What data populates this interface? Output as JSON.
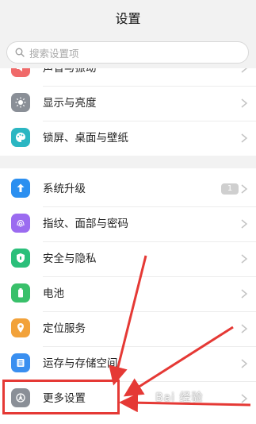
{
  "header": {
    "title": "设置"
  },
  "search": {
    "placeholder": "搜索设置项"
  },
  "group1": {
    "items": [
      {
        "label": "声音与振动",
        "icon": "sound-icon",
        "color": "#f06a6a"
      },
      {
        "label": "显示与亮度",
        "icon": "sun-icon",
        "color": "#8a8f97"
      },
      {
        "label": "锁屏、桌面与壁纸",
        "icon": "palette-icon",
        "color": "#2bb6c2"
      }
    ]
  },
  "group2": {
    "items": [
      {
        "label": "系统升级",
        "icon": "update-icon",
        "color": "#2b8ff0",
        "badge": "1"
      },
      {
        "label": "指纹、面部与密码",
        "icon": "fingerprint-icon",
        "color": "#9b6bf0"
      },
      {
        "label": "安全与隐私",
        "icon": "shield-icon",
        "color": "#2bbf7a"
      },
      {
        "label": "电池",
        "icon": "battery-icon",
        "color": "#39c06a"
      },
      {
        "label": "定位服务",
        "icon": "location-icon",
        "color": "#f2a23a"
      },
      {
        "label": "运存与存储空间",
        "icon": "storage-icon",
        "color": "#3a8ff0"
      },
      {
        "label": "更多设置",
        "icon": "more-settings-icon",
        "color": "#8a8f97"
      }
    ]
  },
  "annotation": {
    "color": "#e53935",
    "watermark": "Bai 经验"
  }
}
